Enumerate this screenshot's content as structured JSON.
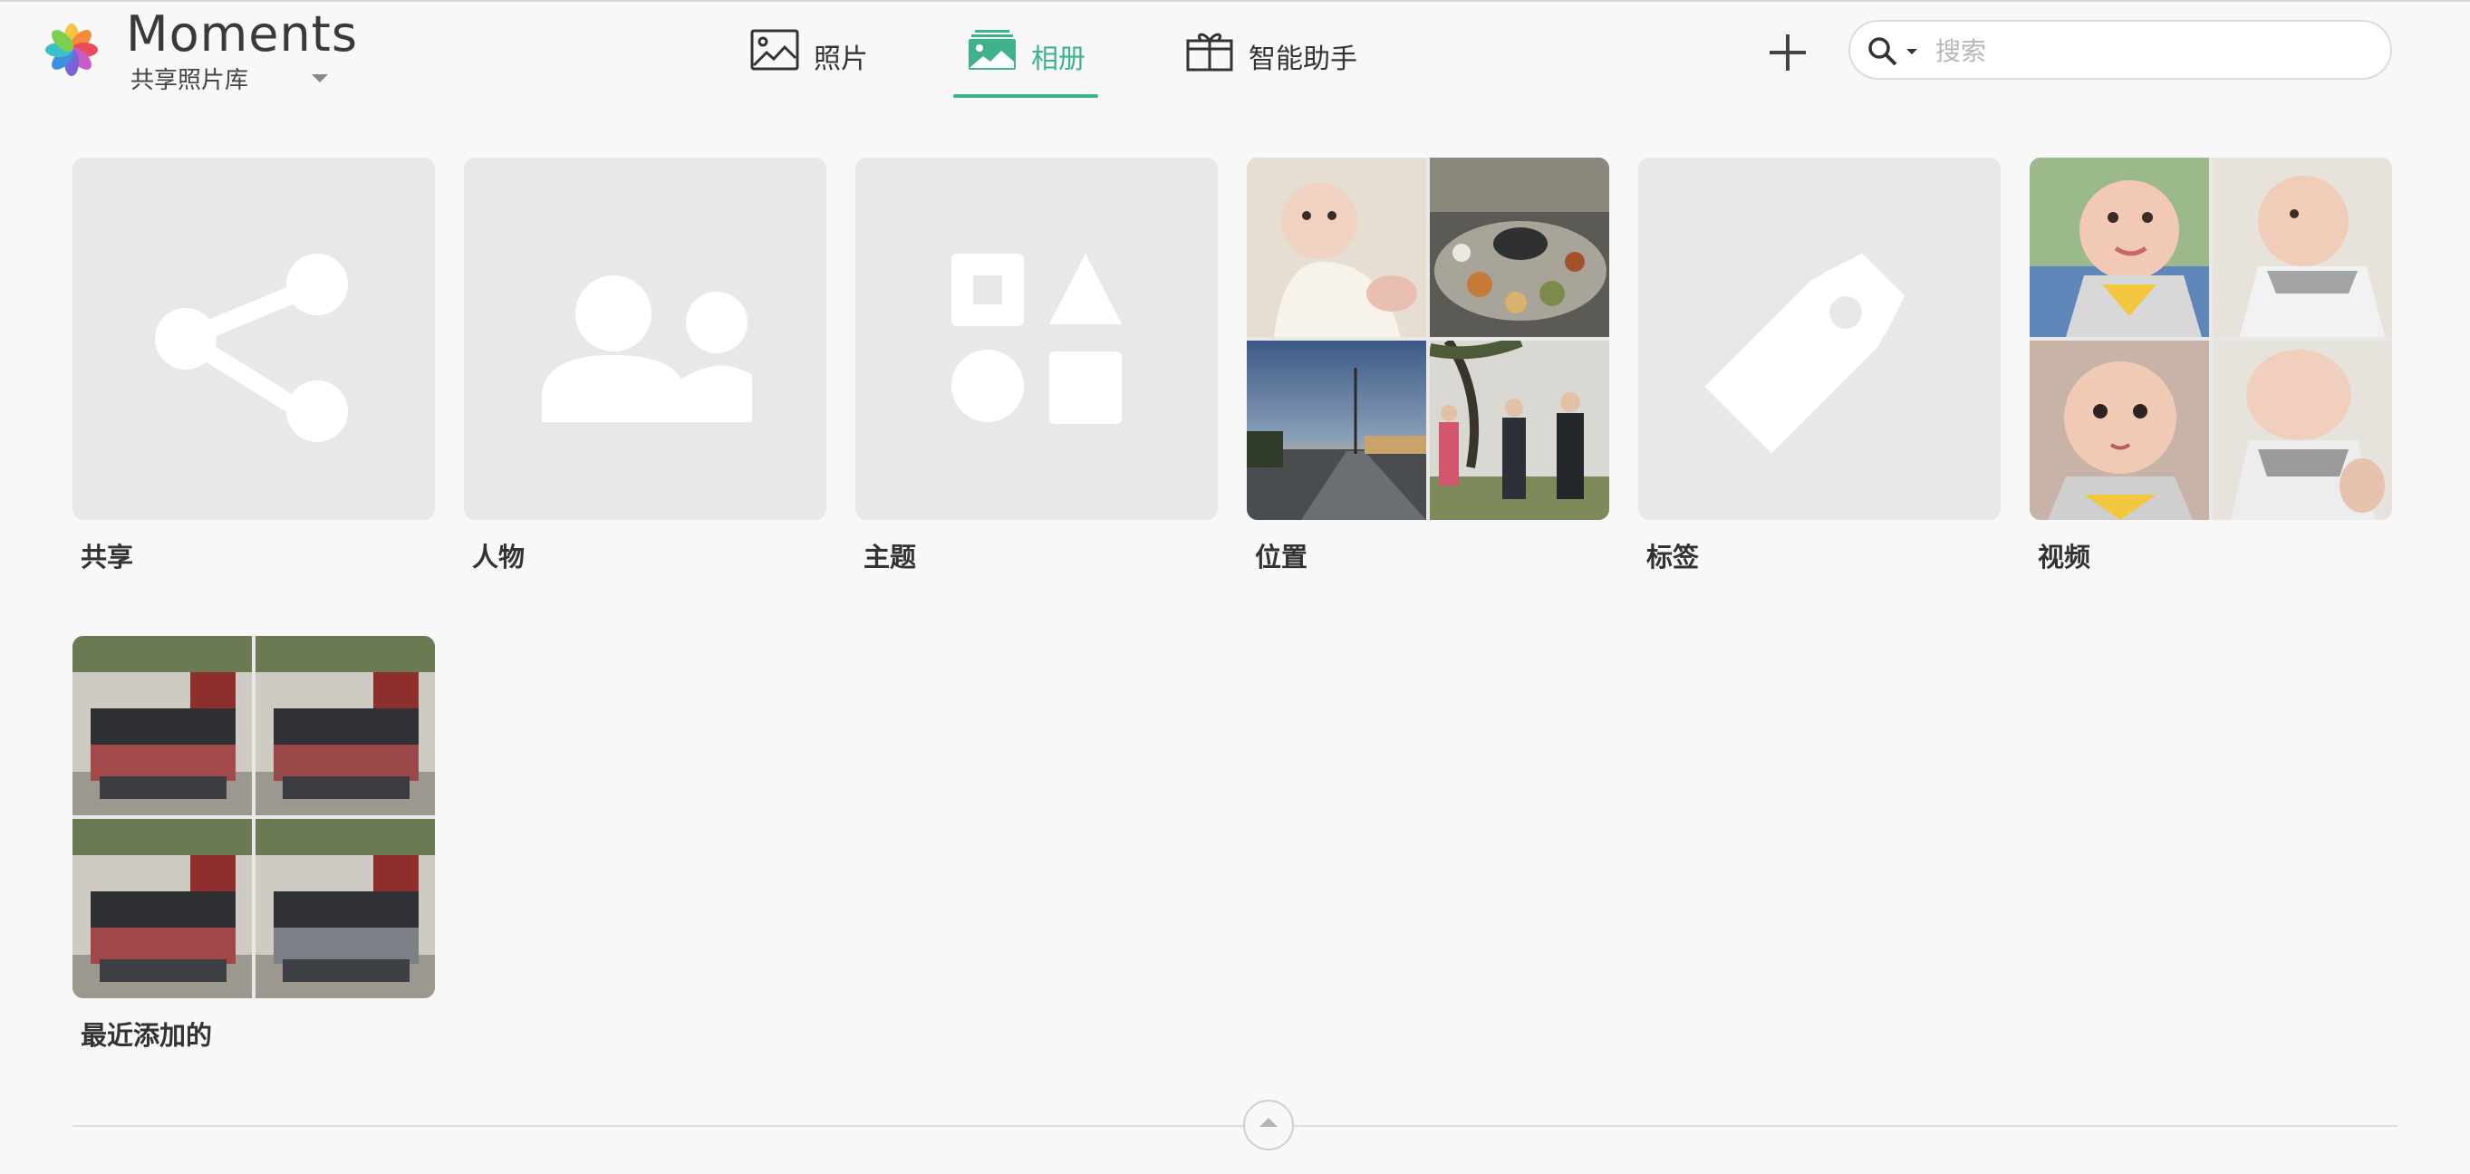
{
  "app": {
    "title": "Moments",
    "library_name": "共享照片库"
  },
  "nav": {
    "tabs": [
      {
        "label": "照片",
        "icon": "image-icon",
        "active": false
      },
      {
        "label": "相册",
        "icon": "album-stack-icon",
        "active": true
      },
      {
        "label": "智能助手",
        "icon": "gift-icon",
        "active": false
      }
    ],
    "active_color": "#3fb28a"
  },
  "toolbar": {
    "add_icon": "plus-icon"
  },
  "search": {
    "placeholder": "搜索",
    "value": ""
  },
  "albums": [
    {
      "label": "共享",
      "icon": "share-icon"
    },
    {
      "label": "人物",
      "icon": "people-icon"
    },
    {
      "label": "主题",
      "icon": "shapes-icon"
    },
    {
      "label": "位置",
      "thumbnails": [
        "baby-photo",
        "dinner-table-photo",
        "street-sunset-photo",
        "elders-outdoor-photo"
      ]
    },
    {
      "label": "标签",
      "icon": "tag-icon"
    },
    {
      "label": "视频",
      "thumbnails": [
        "baby-photo-1",
        "baby-photo-2",
        "baby-photo-3",
        "baby-photo-4"
      ]
    },
    {
      "label": "最近添加的",
      "thumbnails": [
        "group-photo-1",
        "group-photo-2",
        "group-photo-3",
        "group-photo-4"
      ]
    }
  ],
  "footer": {
    "scroll_top_icon": "chevron-up-icon"
  }
}
